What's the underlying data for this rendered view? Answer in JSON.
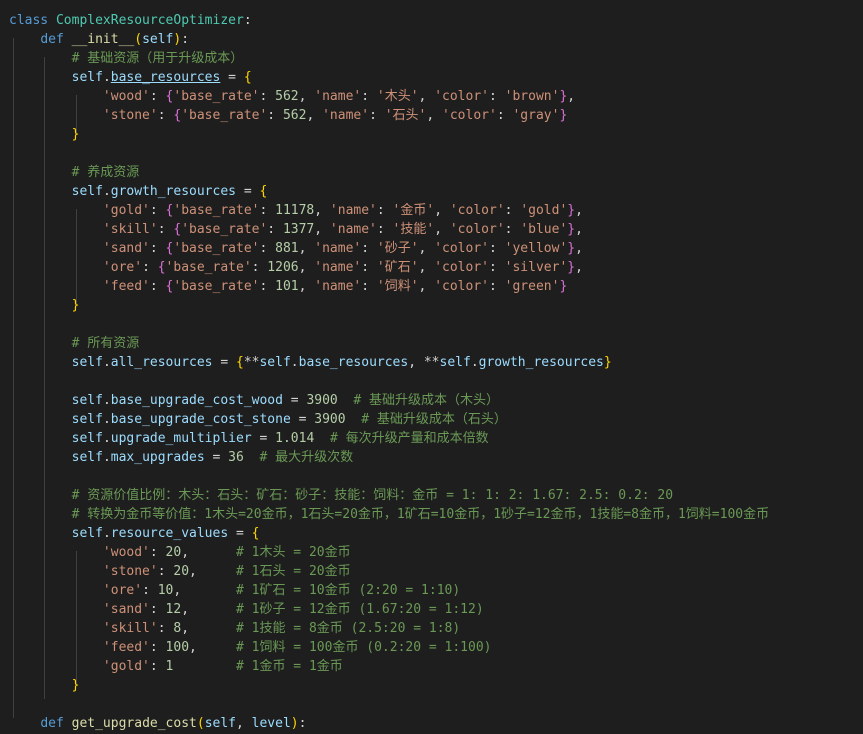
{
  "editor": {
    "lines": [
      [
        {
          "t": "class ",
          "c": "kw"
        },
        {
          "t": "ComplexResourceOptimizer",
          "c": "cls"
        },
        {
          "t": ":",
          "c": "op"
        }
      ],
      [
        {
          "t": "    "
        },
        {
          "t": "def ",
          "c": "kw"
        },
        {
          "t": "__init__",
          "c": "fn"
        },
        {
          "t": "(",
          "c": "b1"
        },
        {
          "t": "self",
          "c": "self"
        },
        {
          "t": ")",
          "c": "b1"
        },
        {
          "t": ":",
          "c": "op"
        }
      ],
      [
        {
          "t": "        "
        },
        {
          "t": "# 基础资源（用于升级成本）",
          "c": "cmt"
        }
      ],
      [
        {
          "t": "        "
        },
        {
          "t": "self",
          "c": "self"
        },
        {
          "t": "."
        },
        {
          "t": "base_resources",
          "c": "attr u"
        },
        {
          "t": " = "
        },
        {
          "t": "{",
          "c": "b1"
        }
      ],
      [
        {
          "t": "            "
        },
        {
          "t": "'wood'",
          "c": "str"
        },
        {
          "t": ": "
        },
        {
          "t": "{",
          "c": "b2"
        },
        {
          "t": "'base_rate'",
          "c": "str"
        },
        {
          "t": ": "
        },
        {
          "t": "562",
          "c": "num"
        },
        {
          "t": ", "
        },
        {
          "t": "'name'",
          "c": "str"
        },
        {
          "t": ": "
        },
        {
          "t": "'木头'",
          "c": "str"
        },
        {
          "t": ", "
        },
        {
          "t": "'color'",
          "c": "str"
        },
        {
          "t": ": "
        },
        {
          "t": "'brown'",
          "c": "str"
        },
        {
          "t": "}",
          "c": "b2"
        },
        {
          "t": ","
        }
      ],
      [
        {
          "t": "            "
        },
        {
          "t": "'stone'",
          "c": "str"
        },
        {
          "t": ": "
        },
        {
          "t": "{",
          "c": "b2"
        },
        {
          "t": "'base_rate'",
          "c": "str"
        },
        {
          "t": ": "
        },
        {
          "t": "562",
          "c": "num"
        },
        {
          "t": ", "
        },
        {
          "t": "'name'",
          "c": "str"
        },
        {
          "t": ": "
        },
        {
          "t": "'石头'",
          "c": "str"
        },
        {
          "t": ", "
        },
        {
          "t": "'color'",
          "c": "str"
        },
        {
          "t": ": "
        },
        {
          "t": "'gray'",
          "c": "str"
        },
        {
          "t": "}",
          "c": "b2"
        }
      ],
      [
        {
          "t": "        "
        },
        {
          "t": "}",
          "c": "b1"
        }
      ],
      [],
      [
        {
          "t": "        "
        },
        {
          "t": "# 养成资源",
          "c": "cmt"
        }
      ],
      [
        {
          "t": "        "
        },
        {
          "t": "self",
          "c": "self"
        },
        {
          "t": "."
        },
        {
          "t": "growth_resources",
          "c": "attr"
        },
        {
          "t": " = "
        },
        {
          "t": "{",
          "c": "b1"
        }
      ],
      [
        {
          "t": "            "
        },
        {
          "t": "'gold'",
          "c": "str"
        },
        {
          "t": ": "
        },
        {
          "t": "{",
          "c": "b2"
        },
        {
          "t": "'base_rate'",
          "c": "str"
        },
        {
          "t": ": "
        },
        {
          "t": "11178",
          "c": "num"
        },
        {
          "t": ", "
        },
        {
          "t": "'name'",
          "c": "str"
        },
        {
          "t": ": "
        },
        {
          "t": "'金币'",
          "c": "str"
        },
        {
          "t": ", "
        },
        {
          "t": "'color'",
          "c": "str"
        },
        {
          "t": ": "
        },
        {
          "t": "'gold'",
          "c": "str"
        },
        {
          "t": "}",
          "c": "b2"
        },
        {
          "t": ","
        }
      ],
      [
        {
          "t": "            "
        },
        {
          "t": "'skill'",
          "c": "str"
        },
        {
          "t": ": "
        },
        {
          "t": "{",
          "c": "b2"
        },
        {
          "t": "'base_rate'",
          "c": "str"
        },
        {
          "t": ": "
        },
        {
          "t": "1377",
          "c": "num"
        },
        {
          "t": ", "
        },
        {
          "t": "'name'",
          "c": "str"
        },
        {
          "t": ": "
        },
        {
          "t": "'技能'",
          "c": "str"
        },
        {
          "t": ", "
        },
        {
          "t": "'color'",
          "c": "str"
        },
        {
          "t": ": "
        },
        {
          "t": "'blue'",
          "c": "str"
        },
        {
          "t": "}",
          "c": "b2"
        },
        {
          "t": ","
        }
      ],
      [
        {
          "t": "            "
        },
        {
          "t": "'sand'",
          "c": "str"
        },
        {
          "t": ": "
        },
        {
          "t": "{",
          "c": "b2"
        },
        {
          "t": "'base_rate'",
          "c": "str"
        },
        {
          "t": ": "
        },
        {
          "t": "881",
          "c": "num"
        },
        {
          "t": ", "
        },
        {
          "t": "'name'",
          "c": "str"
        },
        {
          "t": ": "
        },
        {
          "t": "'砂子'",
          "c": "str"
        },
        {
          "t": ", "
        },
        {
          "t": "'color'",
          "c": "str"
        },
        {
          "t": ": "
        },
        {
          "t": "'yellow'",
          "c": "str"
        },
        {
          "t": "}",
          "c": "b2"
        },
        {
          "t": ","
        }
      ],
      [
        {
          "t": "            "
        },
        {
          "t": "'ore'",
          "c": "str"
        },
        {
          "t": ": "
        },
        {
          "t": "{",
          "c": "b2"
        },
        {
          "t": "'base_rate'",
          "c": "str"
        },
        {
          "t": ": "
        },
        {
          "t": "1206",
          "c": "num"
        },
        {
          "t": ", "
        },
        {
          "t": "'name'",
          "c": "str"
        },
        {
          "t": ": "
        },
        {
          "t": "'矿石'",
          "c": "str"
        },
        {
          "t": ", "
        },
        {
          "t": "'color'",
          "c": "str"
        },
        {
          "t": ": "
        },
        {
          "t": "'silver'",
          "c": "str"
        },
        {
          "t": "}",
          "c": "b2"
        },
        {
          "t": ","
        }
      ],
      [
        {
          "t": "            "
        },
        {
          "t": "'feed'",
          "c": "str"
        },
        {
          "t": ": "
        },
        {
          "t": "{",
          "c": "b2"
        },
        {
          "t": "'base_rate'",
          "c": "str"
        },
        {
          "t": ": "
        },
        {
          "t": "101",
          "c": "num"
        },
        {
          "t": ", "
        },
        {
          "t": "'name'",
          "c": "str"
        },
        {
          "t": ": "
        },
        {
          "t": "'饲料'",
          "c": "str"
        },
        {
          "t": ", "
        },
        {
          "t": "'color'",
          "c": "str"
        },
        {
          "t": ": "
        },
        {
          "t": "'green'",
          "c": "str"
        },
        {
          "t": "}",
          "c": "b2"
        }
      ],
      [
        {
          "t": "        "
        },
        {
          "t": "}",
          "c": "b1"
        }
      ],
      [],
      [
        {
          "t": "        "
        },
        {
          "t": "# 所有资源",
          "c": "cmt"
        }
      ],
      [
        {
          "t": "        "
        },
        {
          "t": "self",
          "c": "self"
        },
        {
          "t": "."
        },
        {
          "t": "all_resources",
          "c": "attr"
        },
        {
          "t": " = "
        },
        {
          "t": "{",
          "c": "b1"
        },
        {
          "t": "**"
        },
        {
          "t": "self",
          "c": "self"
        },
        {
          "t": "."
        },
        {
          "t": "base_resources",
          "c": "attr"
        },
        {
          "t": ", "
        },
        {
          "t": "**"
        },
        {
          "t": "self",
          "c": "self"
        },
        {
          "t": "."
        },
        {
          "t": "growth_resources",
          "c": "attr"
        },
        {
          "t": "}",
          "c": "b1"
        }
      ],
      [],
      [
        {
          "t": "        "
        },
        {
          "t": "self",
          "c": "self"
        },
        {
          "t": "."
        },
        {
          "t": "base_upgrade_cost_wood",
          "c": "attr"
        },
        {
          "t": " = "
        },
        {
          "t": "3900",
          "c": "num"
        },
        {
          "t": "  "
        },
        {
          "t": "# 基础升级成本（木头）",
          "c": "cmt"
        }
      ],
      [
        {
          "t": "        "
        },
        {
          "t": "self",
          "c": "self"
        },
        {
          "t": "."
        },
        {
          "t": "base_upgrade_cost_stone",
          "c": "attr"
        },
        {
          "t": " = "
        },
        {
          "t": "3900",
          "c": "num"
        },
        {
          "t": "  "
        },
        {
          "t": "# 基础升级成本（石头）",
          "c": "cmt"
        }
      ],
      [
        {
          "t": "        "
        },
        {
          "t": "self",
          "c": "self"
        },
        {
          "t": "."
        },
        {
          "t": "upgrade_multiplier",
          "c": "attr"
        },
        {
          "t": " = "
        },
        {
          "t": "1.014",
          "c": "num"
        },
        {
          "t": "  "
        },
        {
          "t": "# 每次升级产量和成本倍数",
          "c": "cmt"
        }
      ],
      [
        {
          "t": "        "
        },
        {
          "t": "self",
          "c": "self"
        },
        {
          "t": "."
        },
        {
          "t": "max_upgrades",
          "c": "attr"
        },
        {
          "t": " = "
        },
        {
          "t": "36",
          "c": "num"
        },
        {
          "t": "  "
        },
        {
          "t": "# 最大升级次数",
          "c": "cmt"
        }
      ],
      [],
      [
        {
          "t": "        "
        },
        {
          "t": "# 资源价值比例：木头：石头：矿石：砂子：技能：饲料：金币 = 1: 1: 2: 1.67: 2.5: 0.2: 20",
          "c": "cmt"
        }
      ],
      [
        {
          "t": "        "
        },
        {
          "t": "# 转换为金币等价值：1木头=20金币，1石头=20金币，1矿石=10金币，1砂子=12金币，1技能=8金币，1饲料=100金币",
          "c": "cmt"
        }
      ],
      [
        {
          "t": "        "
        },
        {
          "t": "self",
          "c": "self"
        },
        {
          "t": "."
        },
        {
          "t": "resource_values",
          "c": "attr"
        },
        {
          "t": " = "
        },
        {
          "t": "{",
          "c": "b1"
        }
      ],
      [
        {
          "t": "            "
        },
        {
          "t": "'wood'",
          "c": "str"
        },
        {
          "t": ": "
        },
        {
          "t": "20",
          "c": "num"
        },
        {
          "t": ",      "
        },
        {
          "t": "# 1木头 = 20金币",
          "c": "cmt"
        }
      ],
      [
        {
          "t": "            "
        },
        {
          "t": "'stone'",
          "c": "str"
        },
        {
          "t": ": "
        },
        {
          "t": "20",
          "c": "num"
        },
        {
          "t": ",     "
        },
        {
          "t": "# 1石头 = 20金币",
          "c": "cmt"
        }
      ],
      [
        {
          "t": "            "
        },
        {
          "t": "'ore'",
          "c": "str"
        },
        {
          "t": ": "
        },
        {
          "t": "10",
          "c": "num"
        },
        {
          "t": ",       "
        },
        {
          "t": "# 1矿石 = 10金币 (2:20 = 1:10)",
          "c": "cmt"
        }
      ],
      [
        {
          "t": "            "
        },
        {
          "t": "'sand'",
          "c": "str"
        },
        {
          "t": ": "
        },
        {
          "t": "12",
          "c": "num"
        },
        {
          "t": ",      "
        },
        {
          "t": "# 1砂子 = 12金币 (1.67:20 = 1:12)",
          "c": "cmt"
        }
      ],
      [
        {
          "t": "            "
        },
        {
          "t": "'skill'",
          "c": "str"
        },
        {
          "t": ": "
        },
        {
          "t": "8",
          "c": "num"
        },
        {
          "t": ",      "
        },
        {
          "t": "# 1技能 = 8金币 (2.5:20 = 1:8)",
          "c": "cmt"
        }
      ],
      [
        {
          "t": "            "
        },
        {
          "t": "'feed'",
          "c": "str"
        },
        {
          "t": ": "
        },
        {
          "t": "100",
          "c": "num"
        },
        {
          "t": ",     "
        },
        {
          "t": "# 1饲料 = 100金币 (0.2:20 = 1:100)",
          "c": "cmt"
        }
      ],
      [
        {
          "t": "            "
        },
        {
          "t": "'gold'",
          "c": "str"
        },
        {
          "t": ": "
        },
        {
          "t": "1",
          "c": "num"
        },
        {
          "t": "        "
        },
        {
          "t": "# 1金币 = 1金币",
          "c": "cmt"
        }
      ],
      [
        {
          "t": "        "
        },
        {
          "t": "}",
          "c": "b1"
        }
      ],
      [],
      [
        {
          "t": "    "
        },
        {
          "t": "def ",
          "c": "kw"
        },
        {
          "t": "get_upgrade_cost",
          "c": "fn"
        },
        {
          "t": "(",
          "c": "b1"
        },
        {
          "t": "self",
          "c": "self"
        },
        {
          "t": ", "
        },
        {
          "t": "level",
          "c": "self"
        },
        {
          "t": ")",
          "c": "b1"
        },
        {
          "t": ":",
          "c": "op"
        }
      ]
    ]
  }
}
